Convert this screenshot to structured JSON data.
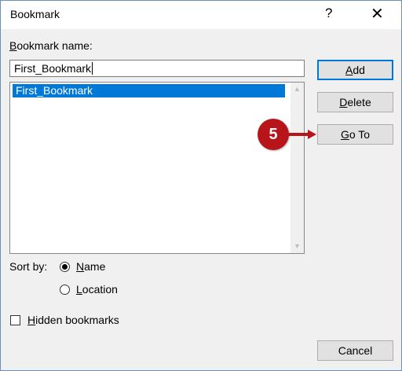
{
  "window": {
    "title": "Bookmark",
    "help_label": "?",
    "close_label": "✕"
  },
  "bookmark_name": {
    "label_underline": "B",
    "label_rest": "ookmark name:",
    "value": "First_Bookmark"
  },
  "list": {
    "items": [
      "First_Bookmark"
    ],
    "scroll_up_glyph": "▲",
    "scroll_down_glyph": "▼"
  },
  "buttons": {
    "add": {
      "underline": "A",
      "rest": "dd"
    },
    "delete": {
      "underline": "D",
      "rest": "elete"
    },
    "goto": {
      "underline": "G",
      "rest": "o To"
    },
    "cancel": "Cancel"
  },
  "sort": {
    "label": "Sort by:",
    "name_option": {
      "underline": "N",
      "rest": "ame",
      "checked": true
    },
    "location_option": {
      "underline": "L",
      "rest": "ocation",
      "checked": false
    }
  },
  "hidden_bookmarks": {
    "underline": "H",
    "rest": "idden bookmarks",
    "checked": false
  },
  "callout": {
    "number": "5",
    "color": "#b8151b"
  },
  "colors": {
    "selection": "#0078d7",
    "dialog_bg": "#f0f0f0"
  }
}
